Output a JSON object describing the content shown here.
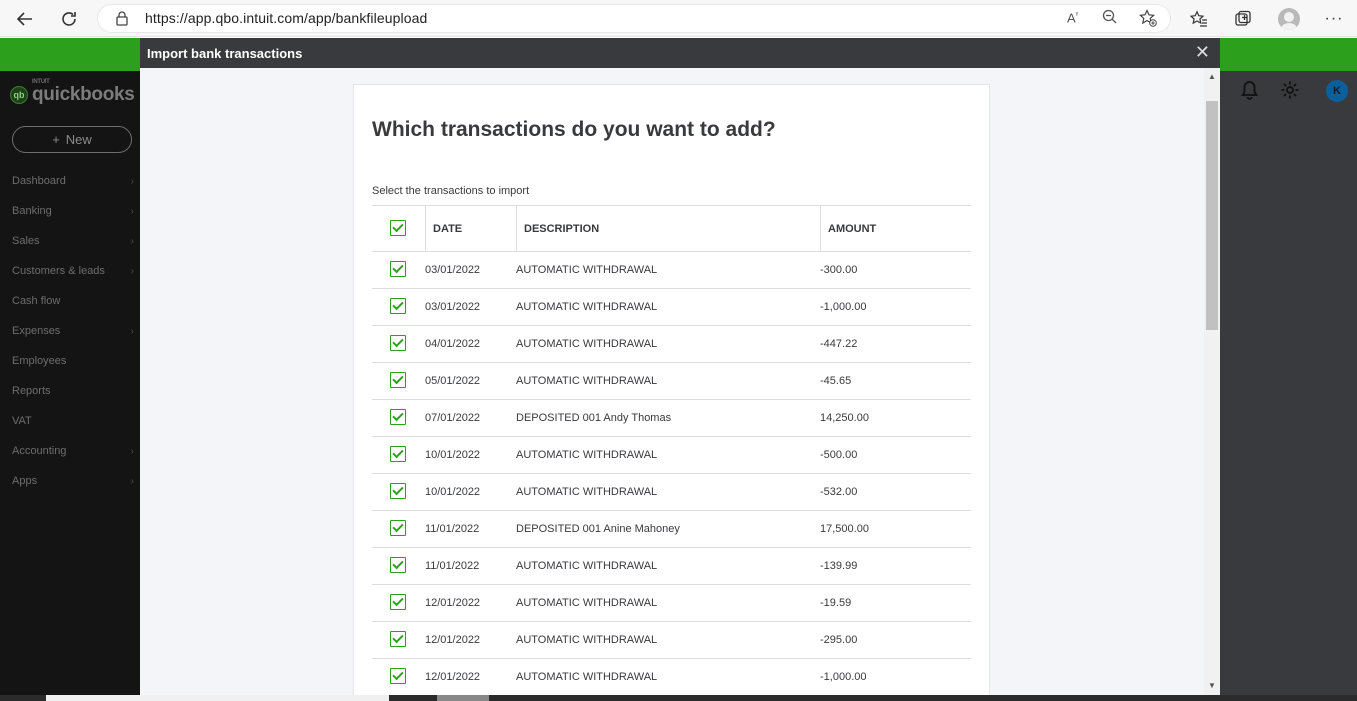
{
  "browser": {
    "url": "https://app.qbo.intuit.com/app/bankfileupload",
    "icons": [
      "back-arrow-icon",
      "refresh-icon",
      "lock-icon",
      "read-aloud-icon",
      "zoom-icon",
      "add-favorite-icon",
      "favorites-icon",
      "collections-icon",
      "profile-icon",
      "more-icon"
    ]
  },
  "sidebar": {
    "logo_intuit": "INTUIT",
    "logo_text": "quickbooks",
    "logo_mark": "qb",
    "new_label": "New",
    "items": [
      {
        "label": "Dashboard",
        "chevron": true
      },
      {
        "label": "Banking",
        "chevron": true
      },
      {
        "label": "Sales",
        "chevron": true
      },
      {
        "label": "Customers & leads",
        "chevron": true
      },
      {
        "label": "Cash flow",
        "chevron": false
      },
      {
        "label": "Expenses",
        "chevron": true
      },
      {
        "label": "Employees",
        "chevron": false
      },
      {
        "label": "Reports",
        "chevron": false
      },
      {
        "label": "VAT",
        "chevron": false
      },
      {
        "label": "Accounting",
        "chevron": true
      },
      {
        "label": "Apps",
        "chevron": true
      }
    ]
  },
  "header": {
    "user_initial": "K"
  },
  "modal": {
    "title": "Import bank transactions",
    "heading": "Which transactions do you want to add?",
    "subheading": "Select the transactions to import",
    "columns": {
      "date": "DATE",
      "description": "DESCRIPTION",
      "amount": "AMOUNT"
    },
    "rows": [
      {
        "date": "03/01/2022",
        "description": "AUTOMATIC WITHDRAWAL",
        "amount": "-300.00",
        "checked": true
      },
      {
        "date": "03/01/2022",
        "description": "AUTOMATIC WITHDRAWAL",
        "amount": "-1,000.00",
        "checked": true
      },
      {
        "date": "04/01/2022",
        "description": "AUTOMATIC WITHDRAWAL",
        "amount": "-447.22",
        "checked": true
      },
      {
        "date": "05/01/2022",
        "description": "AUTOMATIC WITHDRAWAL",
        "amount": "-45.65",
        "checked": true
      },
      {
        "date": "07/01/2022",
        "description": "DEPOSITED 001 Andy Thomas",
        "amount": "14,250.00",
        "checked": true
      },
      {
        "date": "10/01/2022",
        "description": "AUTOMATIC WITHDRAWAL",
        "amount": "-500.00",
        "checked": true
      },
      {
        "date": "10/01/2022",
        "description": "AUTOMATIC WITHDRAWAL",
        "amount": "-532.00",
        "checked": true
      },
      {
        "date": "11/01/2022",
        "description": "DEPOSITED 001 Anine Mahoney",
        "amount": "17,500.00",
        "checked": true
      },
      {
        "date": "11/01/2022",
        "description": "AUTOMATIC WITHDRAWAL",
        "amount": "-139.99",
        "checked": true
      },
      {
        "date": "12/01/2022",
        "description": "AUTOMATIC WITHDRAWAL",
        "amount": "-19.59",
        "checked": true
      },
      {
        "date": "12/01/2022",
        "description": "AUTOMATIC WITHDRAWAL",
        "amount": "-295.00",
        "checked": true
      },
      {
        "date": "12/01/2022",
        "description": "AUTOMATIC WITHDRAWAL",
        "amount": "-1,000.00",
        "checked": true
      }
    ]
  },
  "colors": {
    "brand_green": "#2ca01c",
    "modal_header": "#393a3d",
    "sidebar_bg": "#141414"
  }
}
